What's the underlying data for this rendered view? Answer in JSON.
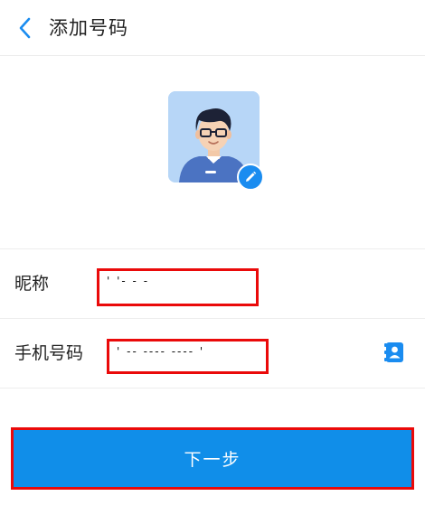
{
  "header": {
    "title": "添加号码",
    "back_icon": "chevron-left-icon"
  },
  "avatar": {
    "edit_icon": "pencil-icon"
  },
  "form": {
    "nickname_label": "昵称",
    "nickname_value": "' '-  -  -",
    "phone_label": "手机号码",
    "phone_value": "' -- ---- ---- '",
    "contacts_icon": "contact-book-icon"
  },
  "actions": {
    "next_label": "下一步"
  },
  "colors": {
    "accent": "#108ee9",
    "highlight": "#ea0a0a"
  }
}
